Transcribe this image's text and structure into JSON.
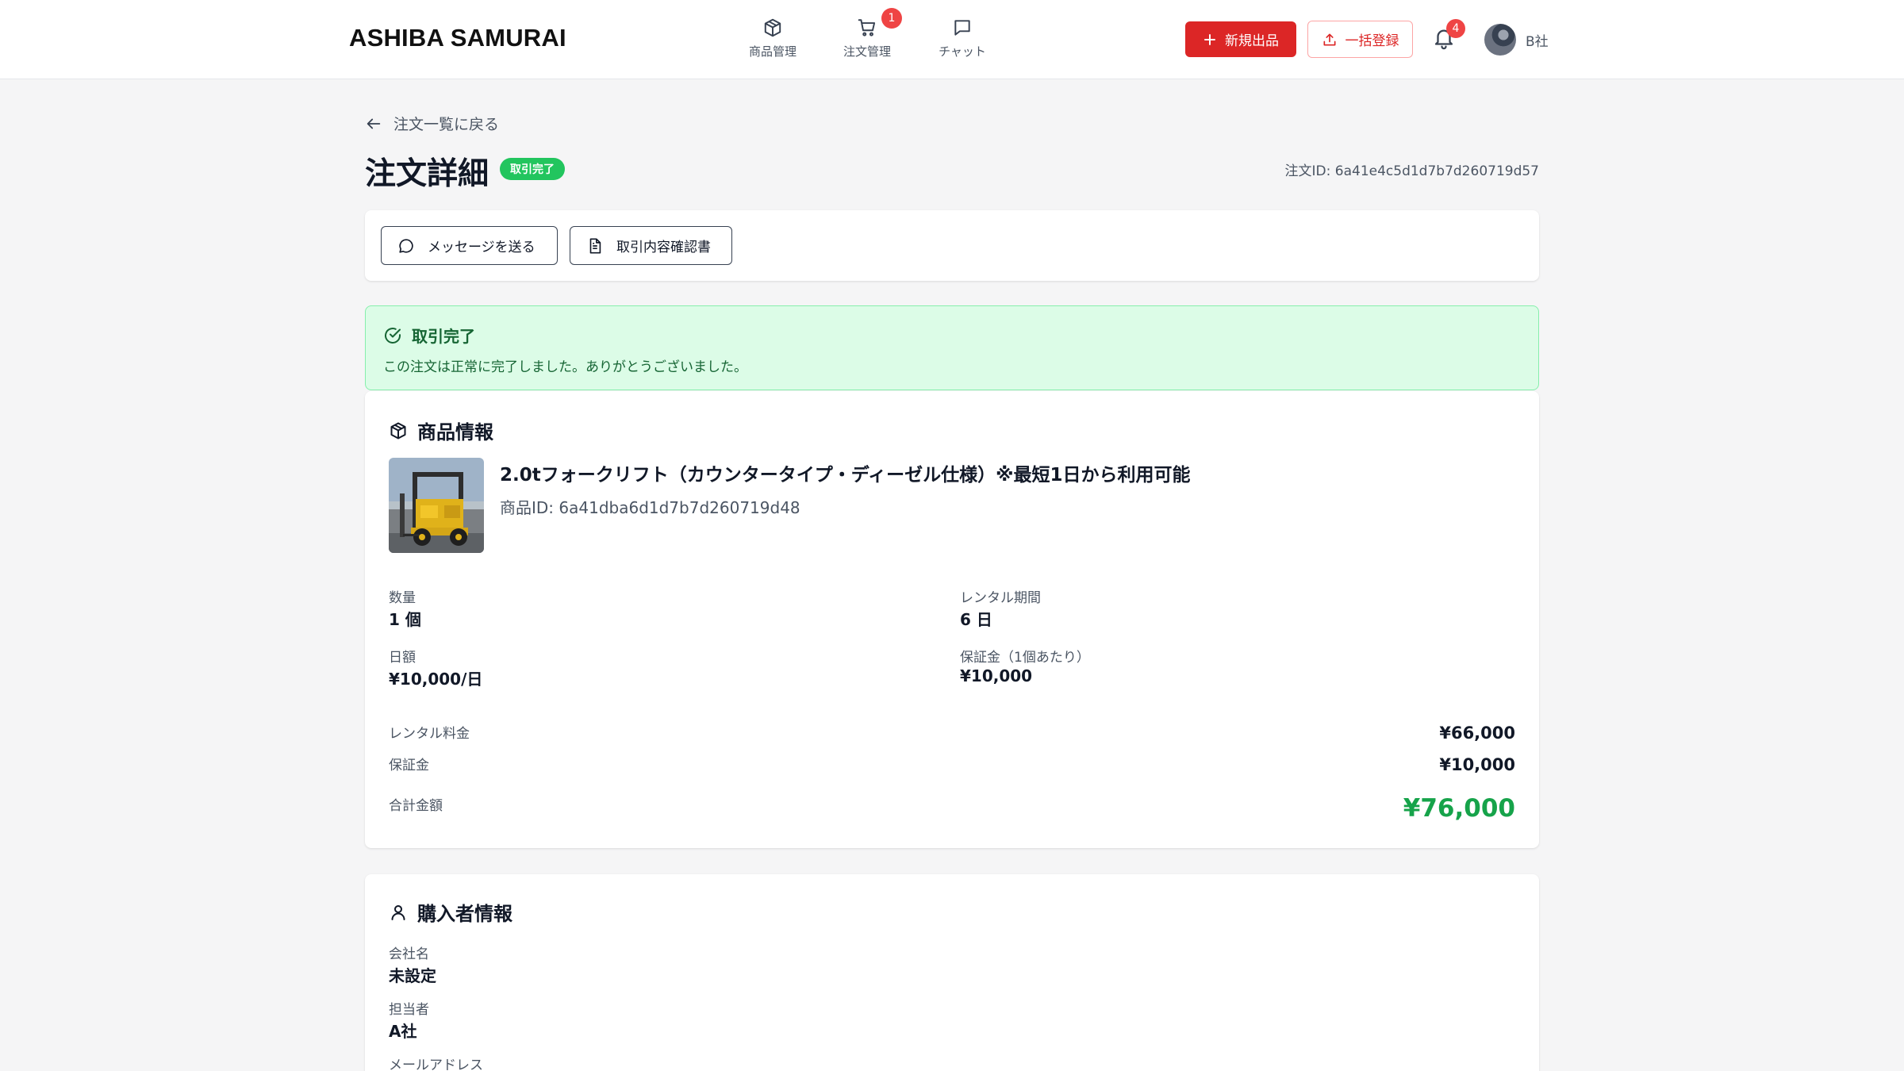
{
  "app": {
    "brand": "ASHIBA SAMURAI"
  },
  "nav": {
    "products": "商品管理",
    "orders": "注文管理",
    "orders_badge": "1",
    "chat": "チャット"
  },
  "header_actions": {
    "new_listing": "新規出品",
    "bulk_register": "一括登録",
    "notifications_badge": "4",
    "user_name": "B社"
  },
  "page": {
    "back_link": "注文一覧に戻る",
    "title": "注文詳細",
    "status_badge": "取引完了",
    "order_id": "注文ID: 6a41e4c5d1d7b7d260719d57"
  },
  "actions": {
    "send_message": "メッセージを送る",
    "transaction_confirmation": "取引内容確認書"
  },
  "status": {
    "title": "取引完了",
    "message": "この注文は正常に完了しました。ありがとうございました。"
  },
  "product": {
    "section_title": "商品情報",
    "name": "2.0tフォークリフト（カウンタータイプ・ディーゼル仕様）※最短1日から利用可能",
    "id": "商品ID: 6a41dba6d1d7b7d260719d48",
    "quantity_label": "数量",
    "quantity_value": "1 個",
    "rental_period_label": "レンタル期間",
    "rental_period_value": "6 日",
    "daily_rate_label": "日額",
    "daily_rate_value": "¥10,000/日",
    "deposit_per_unit_label": "保証金（1個あたり）",
    "deposit_per_unit_value": "¥10,000",
    "rental_fee_label": "レンタル料金",
    "rental_fee_value": "¥66,000",
    "deposit_label": "保証金",
    "deposit_value": "¥10,000",
    "total_label": "合計金額",
    "total_value": "¥76,000"
  },
  "buyer": {
    "section_title": "購入者情報",
    "company_label": "会社名",
    "company_value": "未設定",
    "contact_label": "担当者",
    "contact_value": "A社",
    "email_label": "メールアドレス"
  },
  "colors": {
    "brand_red": "#dc2626",
    "success_green": "#22c55e",
    "total_green": "#16a34a",
    "status_bg": "#dcfce7"
  },
  "icons": {
    "products": "box-icon",
    "orders": "cart-icon",
    "chat": "chat-bubble-icon",
    "new_listing": "plus-icon",
    "bulk_register": "upload-icon",
    "notifications": "bell-icon",
    "back": "arrow-left-icon",
    "message": "message-circle-icon",
    "document": "document-icon",
    "status": "check-circle-icon",
    "buyer": "user-icon"
  }
}
